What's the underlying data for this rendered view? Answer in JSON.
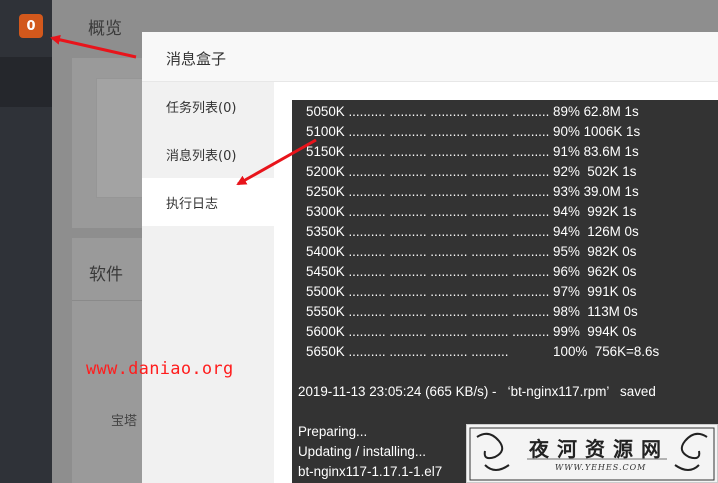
{
  "sidebar": {
    "badge_count": "0"
  },
  "background_page": {
    "title": "概览",
    "software_title": "软件",
    "baota_text": "宝塔"
  },
  "modal": {
    "title": "消息盒子",
    "nav": [
      {
        "label": "任务列表(0)"
      },
      {
        "label": "消息列表(0)"
      },
      {
        "label": "执行日志",
        "active": true
      }
    ]
  },
  "log": {
    "lines": [
      "5050K .......... .......... .......... .......... .......... 89% 62.8M 1s",
      "5100K .......... .......... .......... .......... .......... 90% 1006K 1s",
      "5150K .......... .......... .......... .......... .......... 91% 83.6M 1s",
      "5200K .......... .......... .......... .......... .......... 92%  502K 1s",
      "5250K .......... .......... .......... .......... .......... 93% 39.0M 1s",
      "5300K .......... .......... .......... .......... .......... 94%  992K 1s",
      "5350K .......... .......... .......... .......... .......... 94%  126M 0s",
      "5400K .......... .......... .......... .......... .......... 95%  982K 0s",
      "5450K .......... .......... .......... .......... .......... 96%  962K 0s",
      "5500K .......... .......... .......... .......... .......... 97%  991K 0s",
      "5550K .......... .......... .......... .......... .......... 98%  113M 0s",
      "5600K .......... .......... .......... .......... .......... 99%  994K 0s",
      "5650K .......... .......... .......... ..........            100%  756K=8.6s"
    ],
    "saved_line": "2019-11-13 23:05:24 (665 KB/s) -   ‘bt-nginx117.rpm’   saved",
    "tail_lines": [
      "Preparing...",
      "Updating / installing...",
      "bt-nginx117-1.17.1-1.el7"
    ]
  },
  "annotations": {
    "watermark_url": "www.daniao.org",
    "stamp_title": "夜河资源网",
    "stamp_url": "WWW.YEHES.COM"
  },
  "colors": {
    "badge": "#d2581c",
    "arrow": "#e8141b",
    "watermark": "#ff1d1d",
    "log_bg": "#333333"
  }
}
